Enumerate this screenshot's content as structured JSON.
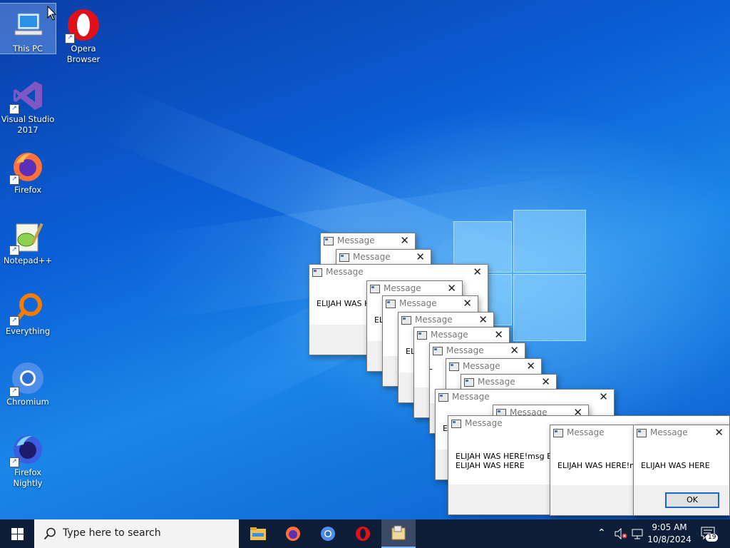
{
  "desktop_icons": [
    {
      "label": "This PC",
      "icon": "computer-icon",
      "selected": true
    },
    {
      "label": "Opera Browser",
      "icon": "opera-icon"
    },
    {
      "label": "Visual Studio 2017",
      "icon": "visual-studio-icon"
    },
    {
      "label": "Firefox",
      "icon": "firefox-icon"
    },
    {
      "label": "Notepad++",
      "icon": "notepad-plus-plus-icon"
    },
    {
      "label": "Everything",
      "icon": "everything-search-icon"
    },
    {
      "label": "Chromium",
      "icon": "chromium-icon"
    },
    {
      "label": "Firefox Nightly",
      "icon": "firefox-nightly-icon"
    }
  ],
  "dialog": {
    "title": "Message",
    "close_glyph": "✕",
    "ok_label": "OK"
  },
  "messages": {
    "m1": "ELIJAH WAS H",
    "m2": "EL",
    "m3": "EL",
    "m4": "EL",
    "m5": "E",
    "big_line1": "ELIJAH WAS HERE!msg ELI",
    "big_line2": "ELIJAH WAS HERE",
    "mid": "ELIJAH WAS HERE!ms",
    "front": "ELIJAH WAS HERE"
  },
  "taskbar": {
    "search_placeholder": "Type here to search",
    "pinned": [
      "file-explorer-icon",
      "firefox-icon",
      "chromium-icon",
      "opera-icon",
      "message-app-icon"
    ],
    "active_app": "message-app-icon",
    "tray": {
      "time": "9:05 AM",
      "date": "10/8/2024",
      "notification_count": "19"
    }
  },
  "colors": {
    "taskbar": "#0e1d38",
    "desktop_blue": "#0b5fd6",
    "ok_border": "#1a66d0"
  }
}
